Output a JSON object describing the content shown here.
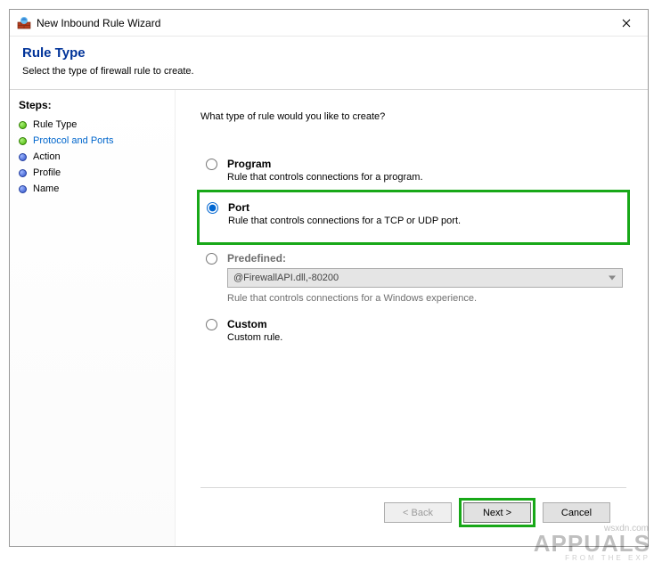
{
  "window": {
    "title": "New Inbound Rule Wizard"
  },
  "header": {
    "title": "Rule Type",
    "subtitle": "Select the type of firewall rule to create."
  },
  "sidebar": {
    "heading": "Steps:",
    "steps": [
      {
        "label": "Rule Type",
        "bullet": "green",
        "active": false
      },
      {
        "label": "Protocol and Ports",
        "bullet": "green",
        "active": true
      },
      {
        "label": "Action",
        "bullet": "blue",
        "active": false
      },
      {
        "label": "Profile",
        "bullet": "blue",
        "active": false
      },
      {
        "label": "Name",
        "bullet": "blue",
        "active": false
      }
    ]
  },
  "content": {
    "prompt": "What type of rule would you like to create?",
    "options": {
      "program": {
        "label": "Program",
        "desc": "Rule that controls connections for a program."
      },
      "port": {
        "label": "Port",
        "desc": "Rule that controls connections for a TCP or UDP port."
      },
      "predefined": {
        "label": "Predefined:",
        "selected_value": "@FirewallAPI.dll,-80200",
        "desc": "Rule that controls connections for a Windows experience."
      },
      "custom": {
        "label": "Custom",
        "desc": "Custom rule."
      }
    },
    "selected": "port"
  },
  "footer": {
    "back": "< Back",
    "next": "Next >",
    "cancel": "Cancel"
  },
  "watermark": {
    "brand": "APPUALS",
    "tagline": "FROM   THE   EXP",
    "url": "wsxdn.com"
  }
}
